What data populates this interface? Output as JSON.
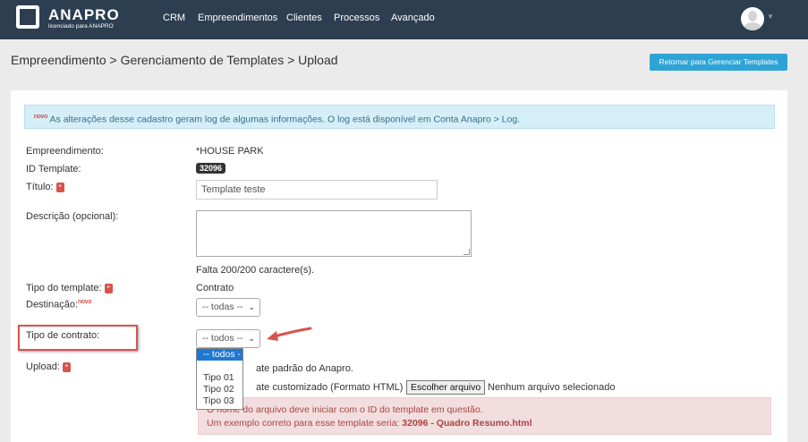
{
  "nav": {
    "brand": "ANAPRO",
    "brand_sub": "licenciado para ANAPRO",
    "items": [
      "CRM",
      "Empreendimentos",
      "Clientes",
      "Processos",
      "Avançado"
    ]
  },
  "breadcrumb": "Empreendimento > Gerenciamento de Templates > Upload",
  "return_button": "Retornar para Gerenciar Templates",
  "info_alert": {
    "novo": "novo",
    "text": "As alterações desse cadastro geram log de algumas informações. O log está disponível em Conta Anapro > Log."
  },
  "form": {
    "empreendimento_label": "Empreendimento:",
    "empreendimento_value": "*HOUSE PARK",
    "id_label": "ID Template:",
    "id_value": "32096",
    "titulo_label": "Título:",
    "titulo_value": "Template teste",
    "descricao_label": "Descrição (opcional):",
    "char_count": "Falta 200/200 caractere(s).",
    "tipo_template_label": "Tipo do template:",
    "tipo_template_value": "Contrato",
    "destinacao_label": "Destinação:",
    "destinacao_novo": "novo",
    "destinacao_value": "-- todas --",
    "tipo_contrato_label": "Tipo de contrato:",
    "tipo_contrato_value": "-- todos --",
    "tipo_contrato_options": [
      "-- todos --",
      "",
      "Tipo 01",
      "Tipo 02",
      "Tipo 03"
    ],
    "upload_label": "Upload:",
    "upload_option1": "ate padrão do Anapro.",
    "upload_option2": "ate customizado (Formato HTML)",
    "file_button": "Escolher arquivo",
    "file_status": "Nenhum arquivo selecionado",
    "required_mark": "*"
  },
  "danger_alert": {
    "line1": "O nome do arquivo deve iniciar com o ID do template em questão.",
    "line2_prefix": "Um exemplo correto para esse template seria: ",
    "line2_bold": "32096 - Quadro Resumo.html"
  },
  "colors": {
    "navbar": "#2c3e50",
    "accent": "#2ea3d6",
    "required": "#d9534f",
    "info_bg": "#d6eef7",
    "danger_bg": "#f2dede",
    "selected_option": "#1e78d4"
  }
}
